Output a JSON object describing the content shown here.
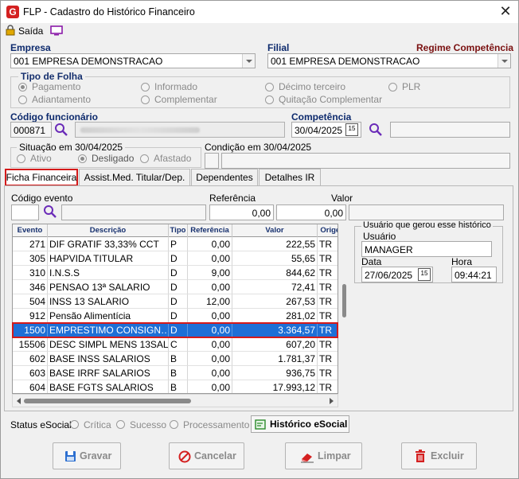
{
  "window": {
    "title": "FLP - Cadastro do Histórico Financeiro",
    "close": "✕",
    "logo": "G"
  },
  "toolbar": {
    "exit_label": "Saída"
  },
  "empresa": {
    "label": "Empresa",
    "value": "001 EMPRESA DEMONSTRACAO"
  },
  "filial": {
    "label": "Filial",
    "value": "001 EMPRESA DEMONSTRACAO"
  },
  "regime": {
    "label": "Regime Competência"
  },
  "tipo_folha": {
    "legend": "Tipo de Folha",
    "options": [
      "Pagamento",
      "Informado",
      "Décimo terceiro",
      "PLR",
      "Adiantamento",
      "Complementar",
      "Quitação Complementar"
    ],
    "selected": "Pagamento"
  },
  "funcionario": {
    "label": "Código funcionário",
    "code": "000871"
  },
  "competencia": {
    "label": "Competência",
    "value": "30/04/2025",
    "cal": "15"
  },
  "situacao": {
    "legend": "Situação em  30/04/2025",
    "options": [
      "Ativo",
      "Desligado",
      "Afastado"
    ],
    "selected": "Desligado"
  },
  "condicao": {
    "legend": "Condição em 30/04/2025"
  },
  "tabs": [
    "Ficha Financeira",
    "Assist.Med. Titular/Dep.",
    "Dependentes",
    "Detalhes IR"
  ],
  "evento_form": {
    "codigo_label": "Código evento",
    "referencia_label": "Referência",
    "referencia_value": "0,00",
    "valor_label": "Valor",
    "valor_value": "0,00"
  },
  "grid": {
    "headers": [
      "Evento",
      "Descrição",
      "Tipo",
      "Referência",
      "Valor",
      "Origem"
    ],
    "rows": [
      [
        "271",
        "DIF GRATIF 33,33% CCT",
        "P",
        "0,00",
        "222,55",
        "TR"
      ],
      [
        "305",
        "HAPVIDA TITULAR",
        "D",
        "0,00",
        "55,65",
        "TR"
      ],
      [
        "310",
        "I.N.S.S",
        "D",
        "9,00",
        "844,62",
        "TR"
      ],
      [
        "346",
        "PENSAO 13ª SALARIO",
        "D",
        "0,00",
        "72,41",
        "TR"
      ],
      [
        "504",
        "INSS 13 SALARIO",
        "D",
        "12,00",
        "267,53",
        "TR"
      ],
      [
        "912",
        "Pensão Alimentícia",
        "D",
        "0,00",
        "281,02",
        "TR"
      ],
      [
        "1500",
        "EMPRESTIMO CONSIGN…",
        "D",
        "0,00",
        "3.364,57",
        "TR"
      ],
      [
        "15506",
        "DESC SIMPL MENS 13SAL",
        "C",
        "0,00",
        "607,20",
        "TR"
      ],
      [
        "602",
        "BASE INSS SALARIOS",
        "B",
        "0,00",
        "1.781,37",
        "TR"
      ],
      [
        "603",
        "BASE IRRF SALARIOS",
        "B",
        "0,00",
        "936,75",
        "TR"
      ],
      [
        "604",
        "BASE FGTS SALARIOS",
        "B",
        "0,00",
        "17.993,12",
        "TR"
      ]
    ],
    "selected_row": 6
  },
  "usuario_box": {
    "legend": "Usuário que gerou esse histórico",
    "usuario_label": "Usuário",
    "usuario_value": "MANAGER",
    "data_label": "Data",
    "data_value": "27/06/2025",
    "hora_label": "Hora",
    "hora_value": "09:44:21",
    "cal": "15"
  },
  "status": {
    "label": "Status eSocial:",
    "options": [
      "Crítica",
      "Sucesso",
      "Processamento"
    ],
    "historico_button": "Histórico eSocial"
  },
  "buttons": {
    "gravar": "Gravar",
    "cancelar": "Cancelar",
    "limpar": "Limpar",
    "excluir": "Excluir"
  },
  "colors": {
    "selection": "#1e6fd6",
    "highlight": "#d41a1a",
    "label_blue": "#0d2a6d",
    "label_red": "#7a1010"
  }
}
